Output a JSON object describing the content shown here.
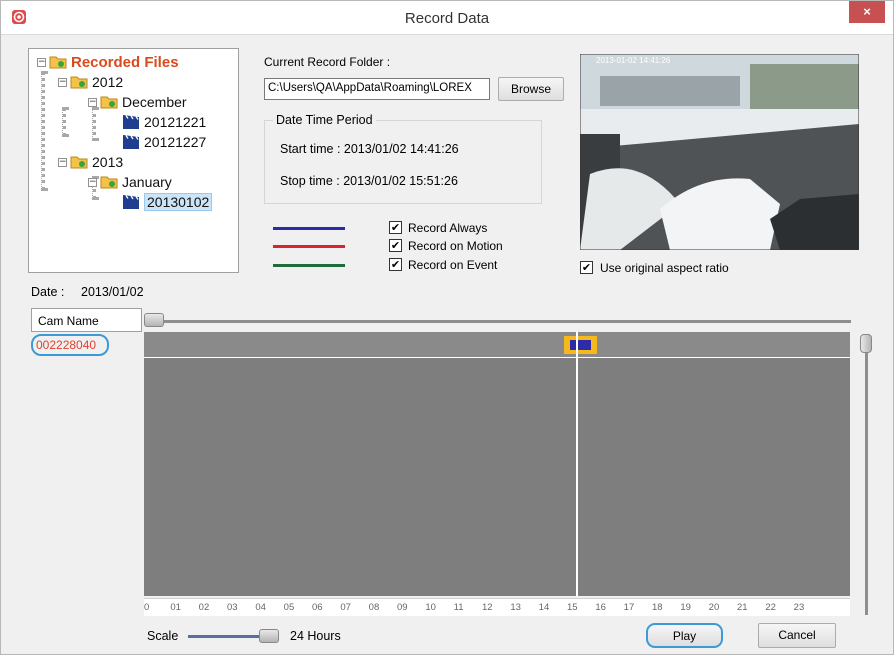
{
  "window": {
    "title": "Record Data",
    "close_glyph": "×",
    "app_icon": "lorex-app-icon"
  },
  "tree": {
    "root": "Recorded Files",
    "year1": "2012",
    "month1": "December",
    "day1": "20121221",
    "day2": "20121227",
    "year2": "2013",
    "month2": "January",
    "day3": "20130102",
    "collapse_glyph": "−"
  },
  "folder_panel": {
    "label": "Current Record Folder :",
    "path": "C:\\Users\\QA\\AppData\\Roaming\\LOREX",
    "browse": "Browse"
  },
  "period": {
    "title": "Date Time Period",
    "start": "Start time : 2013/01/02 14:41:26",
    "stop": "Stop time : 2013/01/02 15:51:26"
  },
  "legend": [
    {
      "label": "Record Always",
      "color": "#2c2ca8",
      "checked": true
    },
    {
      "label": "Record on Motion",
      "color": "#d9232e",
      "checked": true
    },
    {
      "label": "Record on Event",
      "color": "#1f6b3a",
      "checked": true
    }
  ],
  "check_glyph": "✔",
  "aspect": {
    "label": "Use original aspect ratio",
    "checked": true
  },
  "preview": {
    "overlay_text": "2013-01-02 14:41:26"
  },
  "date": {
    "label": "Date :",
    "value": "2013/01/02"
  },
  "camera": {
    "column_header": "Cam Name",
    "name": "002228040"
  },
  "timeline": {
    "hours": [
      "0",
      "01",
      "02",
      "03",
      "04",
      "05",
      "06",
      "07",
      "08",
      "09",
      "10",
      "11",
      "12",
      "13",
      "14",
      "15",
      "16",
      "17",
      "18",
      "19",
      "20",
      "21",
      "22",
      "23"
    ],
    "recording_start_hour": 14.69,
    "recording_end_hour": 15.86,
    "cursor_hour": 15.1,
    "colors": {
      "selection": "#f5b91e",
      "recording": "#2c2ca8"
    }
  },
  "scale": {
    "label": "Scale",
    "value": "24 Hours"
  },
  "buttons": {
    "play": "Play",
    "cancel": "Cancel"
  }
}
